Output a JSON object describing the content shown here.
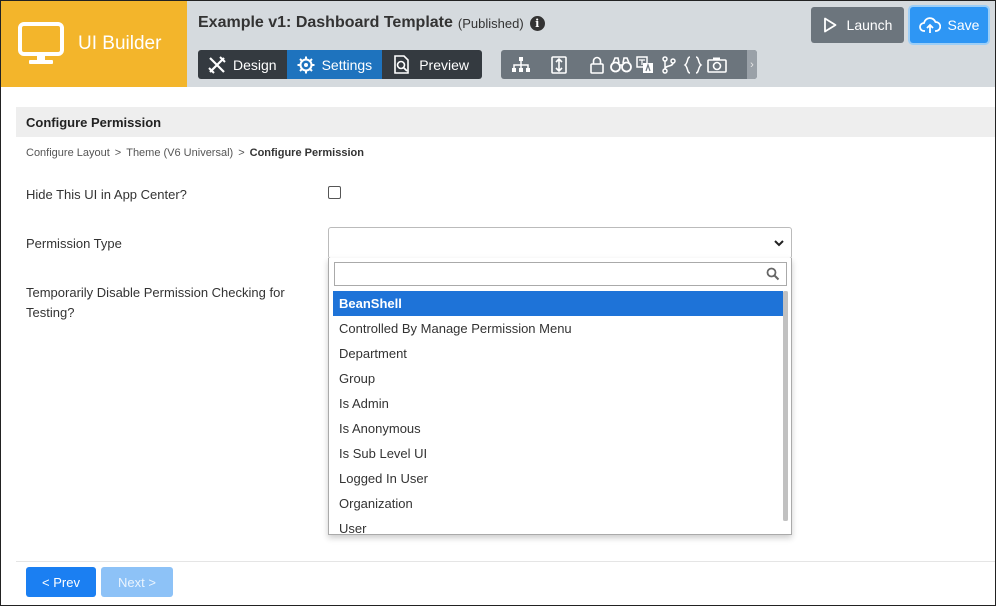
{
  "app": {
    "brand_title": "UI Builder",
    "title": "Example v1: Dashboard Template",
    "status": "(Published)",
    "info_glyph": "i"
  },
  "modes": [
    {
      "label": "Design",
      "icon": "design-tools-icon",
      "active": false
    },
    {
      "label": "Settings",
      "icon": "gear-icon",
      "active": true
    },
    {
      "label": "Preview",
      "icon": "preview-icon",
      "active": false
    }
  ],
  "toolbar": {
    "icons": [
      "sitemap-icon",
      "import-export-icon",
      "lock-icon",
      "binoculars-icon",
      "translate-icon",
      "branch-icon",
      "code-braces-icon",
      "camera-icon"
    ],
    "scroll_glyph": "›"
  },
  "actions": {
    "launch_label": "Launch",
    "save_label": "Save"
  },
  "page": {
    "section_title": "Configure Permission",
    "breadcrumb": [
      "Configure Layout",
      "Theme (V6 Universal)",
      "Configure Permission"
    ],
    "breadcrumb_sep": ">"
  },
  "form": {
    "hide_ui_label": "Hide This UI in App Center?",
    "hide_ui_checked": false,
    "permission_type_label": "Permission Type",
    "permission_type_value": "",
    "disable_check_label_1": "Temporarily Disable Permission Checking for",
    "disable_check_label_2": "Testing?"
  },
  "dropdown": {
    "search_value": "",
    "options": [
      "BeanShell",
      "Controlled By Manage Permission Menu",
      "Department",
      "Group",
      "Is Admin",
      "Is Anonymous",
      "Is Sub Level UI",
      "Logged In User",
      "Organization",
      "User"
    ],
    "highlighted_index": 0
  },
  "footer": {
    "prev_label": "< Prev",
    "next_label": "Next >"
  },
  "colors": {
    "brand": "#f3b52b",
    "header_bg": "#d5dade",
    "accent": "#1e73be",
    "save": "#2e96f4",
    "highlight": "#1e73d8"
  }
}
